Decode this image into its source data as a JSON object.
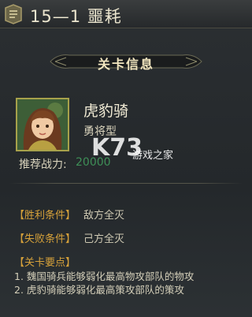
{
  "title": {
    "text": "15—1  噩耗"
  },
  "header": {
    "label": "关卡信息"
  },
  "unit": {
    "name": "虎豹骑",
    "type": "勇将型",
    "power_label": "推荐战力:",
    "power_value": "20000"
  },
  "watermark": {
    "logo": "K73",
    "text": "游戏之家"
  },
  "conditions": {
    "win_label": "【胜利条件】",
    "win_value": "敌方全灭",
    "lose_label": "【失败条件】",
    "lose_value": "己方全灭"
  },
  "tips": {
    "title": "【关卡要点】",
    "items": [
      "1. 魏国骑兵能够弱化最高物攻部队的物攻",
      "2. 虎豹骑能够弱化最高策攻部队的策攻"
    ]
  },
  "colors": {
    "accent_label": "#d6a13a",
    "power_value": "#3e8f57",
    "frame": "#a7a14b"
  },
  "icons": [
    "stage-icon",
    "ribbon-ornament",
    "general-portrait"
  ]
}
